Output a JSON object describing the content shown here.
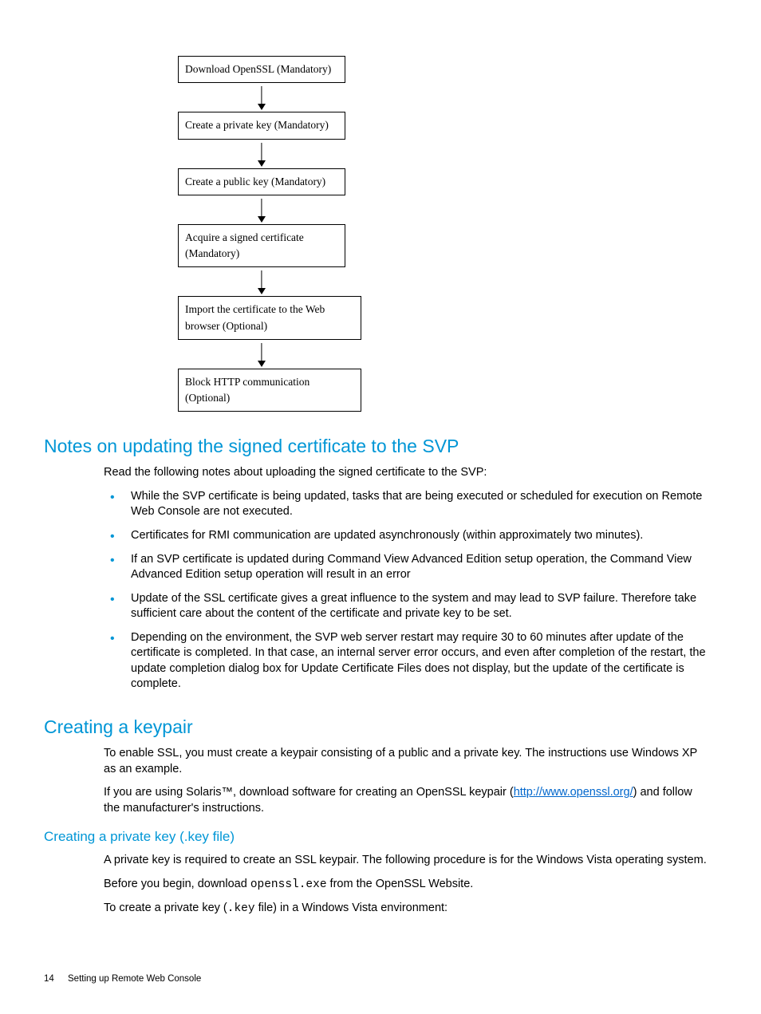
{
  "flowchart": {
    "step1": "Download OpenSSL (Mandatory)",
    "step2": "Create a private key (Mandatory)",
    "step3": "Create a public key (Mandatory)",
    "step4": "Acquire a signed certificate (Mandatory)",
    "step5": "Import the certificate to the Web browser (Optional)",
    "step6": "Block HTTP communication (Optional)"
  },
  "section1": {
    "title": "Notes on updating the signed certificate to the SVP",
    "intro": "Read the following notes about uploading the signed certificate to the SVP:",
    "bullets": [
      "While the SVP certificate is being updated, tasks that are being executed or scheduled for execution on Remote Web Console are not executed.",
      "Certificates for RMI communication are updated asynchronously (within approximately two minutes).",
      "If an SVP certificate is updated during Command View Advanced Edition setup operation, the Command View Advanced Edition setup operation will result in an error",
      "Update of the SSL certificate gives a great influence to the system and may lead to SVP failure. Therefore take sufficient care about the content of the certificate and private key to be set.",
      "Depending on the environment, the SVP web server restart may require 30 to 60 minutes after update of the certificate is completed. In that case, an internal server error occurs, and even after completion of the restart, the update completion dialog box for Update Certificate Files does not display, but the update of the certificate is complete."
    ]
  },
  "section2": {
    "title": "Creating a keypair",
    "p1": "To enable SSL, you must create a keypair consisting of a public and a private key. The instructions use Windows XP as an example.",
    "p2_pre": "If you are using Solaris™, download software for creating an OpenSSL keypair (",
    "p2_link": "http://www.openssl.org/",
    "p2_post": ") and follow the manufacturer's instructions."
  },
  "section3": {
    "title": "Creating a private key (.key file)",
    "p1": "A private key is required to create an SSL keypair. The following procedure is for the Windows Vista operating system.",
    "p2_pre": "Before you begin, download ",
    "p2_code": "openssl.exe",
    "p2_post": " from the OpenSSL Website.",
    "p3_pre": "To create a private key (",
    "p3_code": ".key",
    "p3_post": " file) in a Windows Vista environment:"
  },
  "footer": {
    "page": "14",
    "label": "Setting up Remote Web Console"
  }
}
